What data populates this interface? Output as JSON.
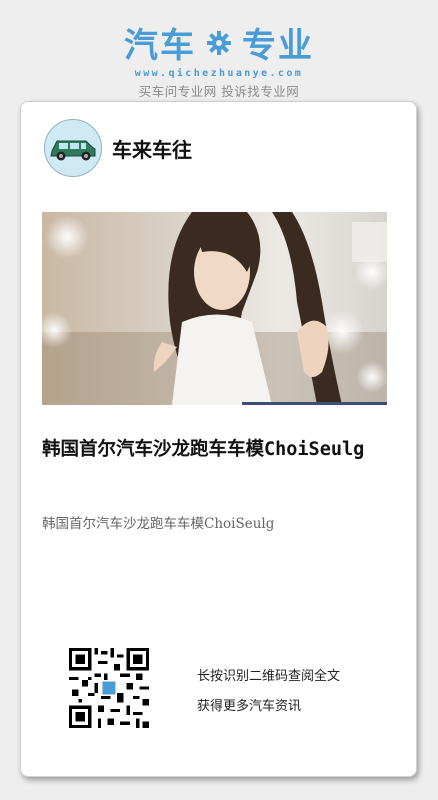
{
  "header": {
    "brand_left": "汽车",
    "brand_right": "专业",
    "url": "www.qichezhuanye.com",
    "tagline": "买车问专业网 投诉找专业网",
    "gear_icon": "gear-icon",
    "brand_color": "#4a9cd6"
  },
  "card": {
    "author_name": "车来车往",
    "avatar_icon": "car-avatar-icon",
    "title": "韩国首尔汽车沙龙跑车车模ChoiSeulg",
    "summary": "韩国首尔汽车沙龙跑车车模ChoiSeulg",
    "qr_icon": "qr-code-icon",
    "qr_caption_line1": "长按识别二维码查阅全文",
    "qr_caption_line2": "获得更多汽车资讯"
  }
}
